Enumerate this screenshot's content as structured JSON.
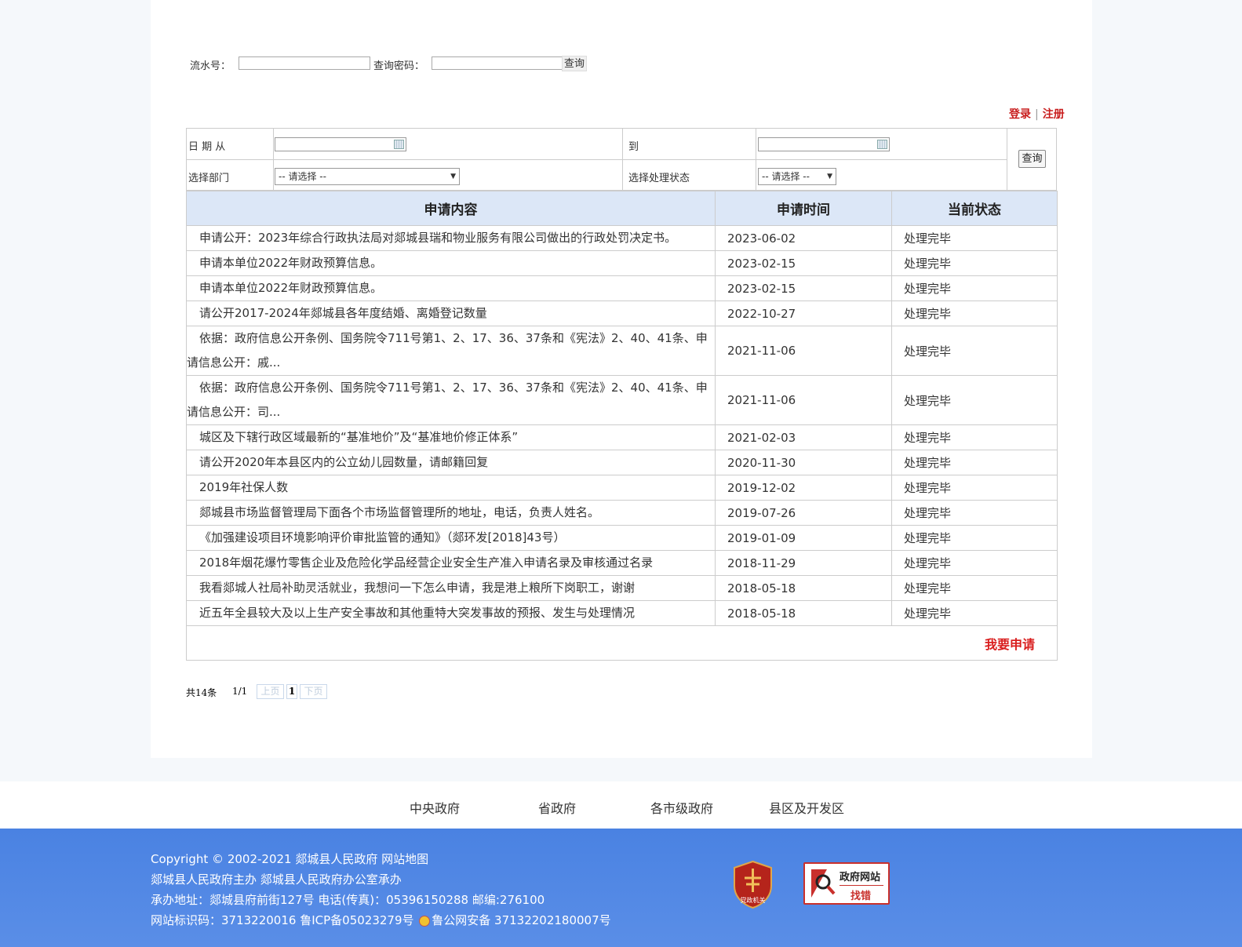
{
  "query_bar": {
    "serial_label": "流水号：",
    "password_label": "查询密码：",
    "button": "查询"
  },
  "auth": {
    "login": "登录",
    "separator": "|",
    "register": "注册"
  },
  "filter": {
    "date_from_label": "日 期 从",
    "date_to_label": "到",
    "dept_label": "选择部门",
    "dept_selected": "-- 请选择 --",
    "status_label": "选择处理状态",
    "status_selected": "-- 请选择 --",
    "button": "查询"
  },
  "table": {
    "headers": [
      "申请内容",
      "申请时间",
      "当前状态"
    ],
    "rows": [
      {
        "content": "申请公开：2023年综合行政执法局对郯城县瑞和物业服务有限公司做出的行政处罚决定书。",
        "date": "2023-06-02",
        "status": "处理完毕"
      },
      {
        "content": "申请本单位2022年财政预算信息。",
        "date": "2023-02-15",
        "status": "处理完毕"
      },
      {
        "content": "申请本单位2022年财政预算信息。",
        "date": "2023-02-15",
        "status": "处理完毕"
      },
      {
        "content": "请公开2017-2024年郯城县各年度结婚、离婚登记数量",
        "date": "2022-10-27",
        "status": "处理完毕"
      },
      {
        "content": "依据：政府信息公开条例、国务院令711号第1、2、17、36、37条和《宪法》2、40、41条、申请信息公开：戚...",
        "date": "2021-11-06",
        "status": "处理完毕"
      },
      {
        "content": "依据：政府信息公开条例、国务院令711号第1、2、17、36、37条和《宪法》2、40、41条、申请信息公开：司...",
        "date": "2021-11-06",
        "status": "处理完毕"
      },
      {
        "content": " 城区及下辖行政区域最新的“基准地价”及“基准地价修正体系”",
        "date": "2021-02-03",
        "status": "处理完毕"
      },
      {
        "content": "请公开2020年本县区内的公立幼儿园数量，请邮籍回复",
        "date": "2020-11-30",
        "status": "处理完毕"
      },
      {
        "content": "2019年社保人数",
        "date": "2019-12-02",
        "status": "处理完毕"
      },
      {
        "content": "郯城县市场监督管理局下面各个市场监督管理所的地址，电话，负责人姓名。",
        "date": "2019-07-26",
        "status": "处理完毕"
      },
      {
        "content": "《加强建设项目环境影响评价审批监管的通知》（郯环发[2018]43号）",
        "date": "2019-01-09",
        "status": "处理完毕"
      },
      {
        "content": "2018年烟花爆竹零售企业及危险化学品经营企业安全生产准入申请名录及审核通过名录",
        "date": "2018-11-29",
        "status": "处理完毕"
      },
      {
        "content": "我看郯城人社局补助灵活就业，我想问一下怎么申请，我是港上粮所下岗职工，谢谢",
        "date": "2018-05-18",
        "status": "处理完毕"
      },
      {
        "content": "近五年全县较大及以上生产安全事故和其他重特大突发事故的预报、发生与处理情况",
        "date": "2018-05-18",
        "status": "处理完毕"
      }
    ],
    "apply_link": "我要申请"
  },
  "pager": {
    "total": "共14条",
    "page_info": "1/1",
    "prev": "上页",
    "current": "1",
    "next": "下页"
  },
  "links": [
    "中央政府",
    "省政府",
    "各市级政府",
    "县区及开发区"
  ],
  "footer": {
    "line1": "Copyright © 2002-2021 郯城县人民政府  网站地图",
    "line2": "郯城县人民政府主办 郯城县人民政府办公室承办",
    "line3": "承办地址：郯城县府前街127号 电话(传真)：05396150288 邮编:276100",
    "line4_a": "网站标识码：3713220016  鲁ICP备05023279号 ",
    "line4_b": "鲁公网安备 37132202180007号",
    "badge_text": "党政机关",
    "jiucuo_top": "政府网站",
    "jiucuo_bottom": "找错"
  },
  "colors": {
    "accent_red": "#c81d1d",
    "header_bg": "#dce7f7",
    "footer_blue": "#4a82e2"
  }
}
